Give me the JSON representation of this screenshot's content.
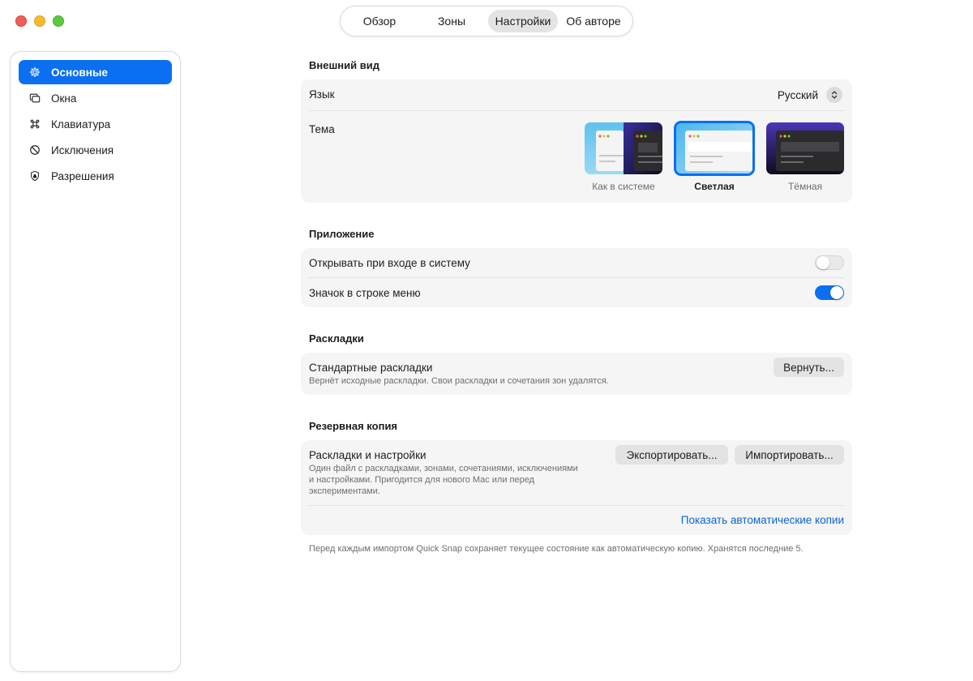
{
  "window": {
    "traffic_lights": [
      "close",
      "minimize",
      "zoom"
    ]
  },
  "top_nav": {
    "tabs": [
      {
        "label": "Обзор"
      },
      {
        "label": "Зоны"
      },
      {
        "label": "Настройки",
        "selected": true
      },
      {
        "label": "Об авторе"
      }
    ]
  },
  "sidebar": {
    "items": [
      {
        "label": "Основные",
        "icon": "gear-icon",
        "active": true
      },
      {
        "label": "Окна",
        "icon": "windows-icon"
      },
      {
        "label": "Клавиатура",
        "icon": "command-icon"
      },
      {
        "label": "Исключения",
        "icon": "prohibited-icon"
      },
      {
        "label": "Разрешения",
        "icon": "shield-icon"
      }
    ]
  },
  "appearance": {
    "title": "Внешний вид",
    "language_label": "Язык",
    "language_value": "Русский",
    "theme_label": "Тема",
    "themes": [
      {
        "label": "Как в системе"
      },
      {
        "label": "Светлая",
        "selected": true
      },
      {
        "label": "Тёмная"
      }
    ]
  },
  "application": {
    "title": "Приложение",
    "launch_at_login_label": "Открывать при входе в систему",
    "launch_at_login": false,
    "menu_bar_icon_label": "Значок в строке меню",
    "menu_bar_icon": true
  },
  "layouts": {
    "title": "Раскладки",
    "default_label": "Стандартные раскладки",
    "default_sub": "Вернёт исходные раскладки. Свои раскладки и сочетания зон удалятся.",
    "reset_button": "Вернуть..."
  },
  "backup": {
    "title": "Резервная копия",
    "label": "Раскладки и настройки",
    "sub_line1": "Один файл с раскладками, зонами, сочетаниями, исключениями",
    "sub_line2": "и настройками. Пригодится для нового Mac или перед",
    "sub_line3": "экспериментами.",
    "export_button": "Экспортировать...",
    "import_button": "Импортировать...",
    "auto_backups_link": "Показать автоматические копии",
    "footnote": "Перед каждым импортом Quick Snap сохраняет текущее состояние как автоматическую копию. Хранятся последние 5."
  },
  "colors": {
    "accent": "#0b6ff1",
    "link": "#0b64d4",
    "card_bg": "#f5f5f5"
  }
}
